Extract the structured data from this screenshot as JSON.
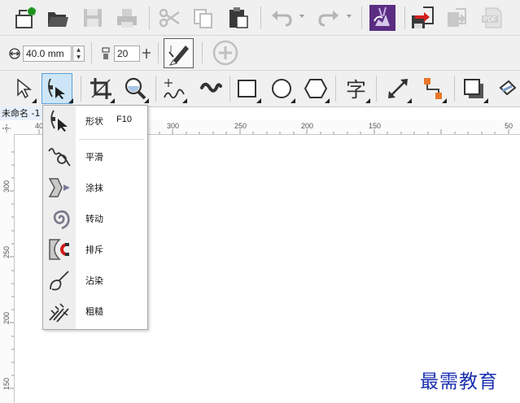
{
  "colors": {
    "accent": "#5a2d82",
    "toolbar_bg": "#f0f0f0",
    "selection_blue": "#3b7dd8",
    "watermark": "#1b2fb0"
  },
  "toolbar_main": {
    "icons": [
      "new-document-icon",
      "open-folder-icon",
      "save-icon",
      "print-icon",
      "cut-icon",
      "copy-icon",
      "paste-icon",
      "undo-icon",
      "redo-icon",
      "launch-icon",
      "export-icon",
      "publish-icon",
      "pdf-icon"
    ]
  },
  "property_bar": {
    "nudge_value": "40.0 mm",
    "nib_value": "20"
  },
  "toolbox": {
    "icons": [
      "pick-tool-icon",
      "shape-tool-icon",
      "crop-tool-icon",
      "zoom-tool-icon",
      "freehand-tool-icon",
      "artistic-media-icon",
      "rectangle-tool-icon",
      "ellipse-tool-icon",
      "polygon-tool-icon",
      "text-tool-icon",
      "dimension-tool-icon",
      "connector-tool-icon",
      "drop-shadow-icon",
      "fill-tool-icon"
    ]
  },
  "document": {
    "tab_label": "未命名 -1"
  },
  "ruler": {
    "h_labels": [
      "40",
      "300",
      "250",
      "200",
      "150",
      "50"
    ],
    "v_labels": [
      "300",
      "250",
      "200",
      "150"
    ]
  },
  "flyout": {
    "items": [
      {
        "label": "形状",
        "shortcut": "F10",
        "icon": "shape-icon"
      },
      {
        "label": "平滑",
        "icon": "smooth-icon"
      },
      {
        "label": "涂抹",
        "icon": "smear-icon"
      },
      {
        "label": "转动",
        "icon": "twirl-icon"
      },
      {
        "label": "排斥",
        "icon": "repel-icon"
      },
      {
        "label": "沾染",
        "icon": "smudge-icon"
      },
      {
        "label": "粗糙",
        "icon": "roughen-icon"
      }
    ]
  },
  "watermark": "最需教育"
}
